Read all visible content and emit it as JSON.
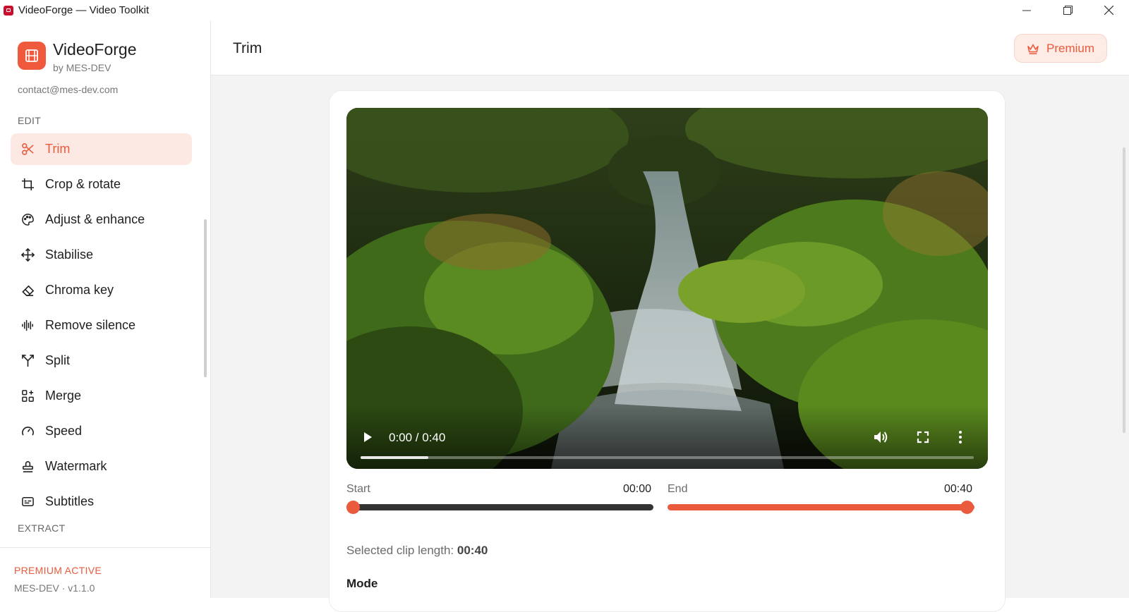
{
  "window": {
    "title": "VideoForge — Video Toolkit"
  },
  "brand": {
    "name": "VideoForge",
    "by": "by MES-DEV",
    "email": "contact@mes-dev.com"
  },
  "sidebar": {
    "sections": {
      "edit": "EDIT",
      "extract": "EXTRACT"
    },
    "items": [
      {
        "label": "Trim",
        "icon": "scissors-icon",
        "active": true
      },
      {
        "label": "Crop & rotate",
        "icon": "crop-icon"
      },
      {
        "label": "Adjust & enhance",
        "icon": "palette-icon"
      },
      {
        "label": "Stabilise",
        "icon": "move-icon"
      },
      {
        "label": "Chroma key",
        "icon": "eraser-icon"
      },
      {
        "label": "Remove silence",
        "icon": "audio-wave-icon"
      },
      {
        "label": "Split",
        "icon": "split-icon"
      },
      {
        "label": "Merge",
        "icon": "merge-icon"
      },
      {
        "label": "Speed",
        "icon": "gauge-icon"
      },
      {
        "label": "Watermark",
        "icon": "stamp-icon"
      },
      {
        "label": "Subtitles",
        "icon": "captions-icon"
      }
    ],
    "footer": {
      "status": "PREMIUM ACTIVE",
      "version": "MES-DEV · v1.1.0"
    }
  },
  "header": {
    "title": "Trim",
    "premium_label": "Premium"
  },
  "player": {
    "time": "0:00 / 0:40",
    "progress": 0.11
  },
  "trim": {
    "start_label": "Start",
    "start_value": "00:00",
    "end_label": "End",
    "end_value": "00:40",
    "clip_length_label": "Selected clip length:",
    "clip_length_value": "00:40",
    "mode_label": "Mode"
  },
  "colors": {
    "accent": "#ea5a3d",
    "accent_soft": "#fde9e3",
    "track_dark": "#333333"
  }
}
